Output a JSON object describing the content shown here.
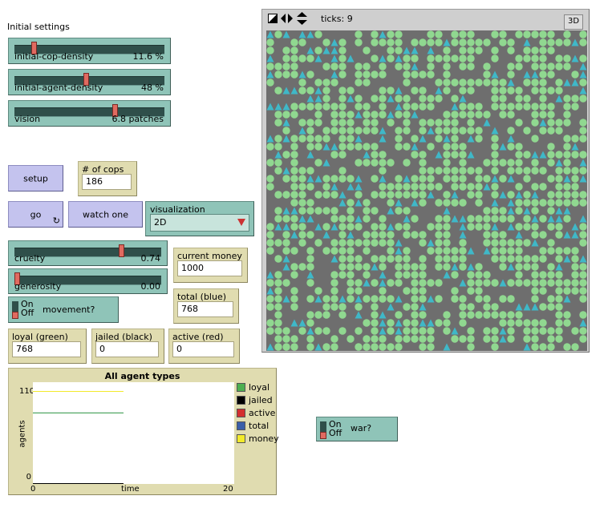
{
  "section_label": "Initial settings",
  "sliders": [
    {
      "name": "initial-cop-density",
      "value": "11.6 %",
      "fraction": 0.116
    },
    {
      "name": "initial-agent-density",
      "value": "48 %",
      "fraction": 0.48
    },
    {
      "name": "vision",
      "value": "6.8 patches",
      "fraction": 0.68
    },
    {
      "name": "cruelty",
      "value": "0.74",
      "fraction": 0.74
    },
    {
      "name": "generosity",
      "value": "0.00",
      "fraction": 0.0
    }
  ],
  "buttons": {
    "setup": "setup",
    "go": "go",
    "watch_one": "watch one"
  },
  "monitors": {
    "cops": {
      "title": "# of cops",
      "value": "186"
    },
    "current_money": {
      "title": "current money",
      "value": "1000"
    },
    "total_blue": {
      "title": "total (blue)",
      "value": "768"
    },
    "loyal_green": {
      "title": "loyal (green)",
      "value": "768"
    },
    "jailed_black": {
      "title": "jailed (black)",
      "value": "0"
    },
    "active_red": {
      "title": "active (red)",
      "value": "0"
    }
  },
  "chooser": {
    "title": "visualization",
    "value": "2D"
  },
  "switches": {
    "on_label": "On",
    "off_label": "Off",
    "movement": "movement?",
    "war": "war?"
  },
  "view": {
    "ticks_label": "ticks: 9",
    "btn_3d": "3D",
    "colors": {
      "background": "#6e6e6e",
      "agent": "#90d890",
      "cop": "#3fb8c8"
    }
  },
  "plot": {
    "title": "All agent types",
    "ylabel": "agents",
    "xlabel": "time",
    "y_max_label": "1100",
    "y_min_label": "0",
    "x_min_label": "0",
    "x_max_label": "20",
    "legend": [
      {
        "name": "loyal",
        "color": "#4caf50"
      },
      {
        "name": "jailed",
        "color": "#000000"
      },
      {
        "name": "active",
        "color": "#d32f2f"
      },
      {
        "name": "total",
        "color": "#3a5ea8"
      },
      {
        "name": "money",
        "color": "#f2ea2a"
      }
    ]
  },
  "chart_data": {
    "type": "line",
    "title": "All agent types",
    "xlabel": "time",
    "ylabel": "agents",
    "xlim": [
      0,
      20
    ],
    "ylim": [
      0,
      1100
    ],
    "series": [
      {
        "name": "money",
        "color": "#f2ea2a",
        "x": [
          0,
          9
        ],
        "values": [
          1000,
          1000
        ]
      },
      {
        "name": "total",
        "color": "#3a5ea8",
        "x": [
          0,
          9
        ],
        "values": [
          768,
          768
        ]
      },
      {
        "name": "loyal",
        "color": "#4caf50",
        "x": [
          0,
          9
        ],
        "values": [
          768,
          768
        ]
      },
      {
        "name": "active",
        "color": "#d32f2f",
        "x": [
          0,
          9
        ],
        "values": [
          0,
          0
        ]
      },
      {
        "name": "jailed",
        "color": "#000000",
        "x": [
          0,
          9
        ],
        "values": [
          0,
          0
        ]
      }
    ]
  }
}
